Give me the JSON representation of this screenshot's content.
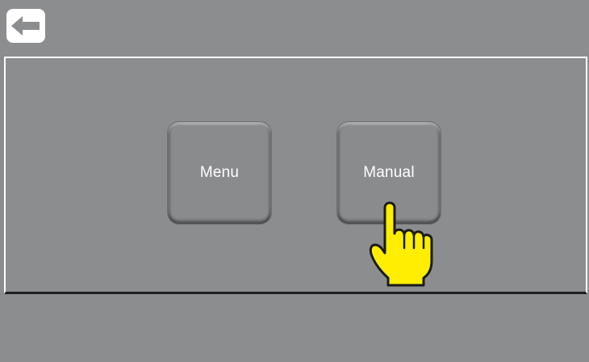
{
  "header": {
    "back_icon": "back-arrow-icon"
  },
  "main": {
    "buttons": [
      {
        "label": "Menu"
      },
      {
        "label": "Manual"
      }
    ],
    "pointer_icon": "pointing-hand-icon"
  },
  "colors": {
    "background": "#8c8d8f",
    "button_text": "#ffffff",
    "hand_fill": "#ffee00"
  }
}
